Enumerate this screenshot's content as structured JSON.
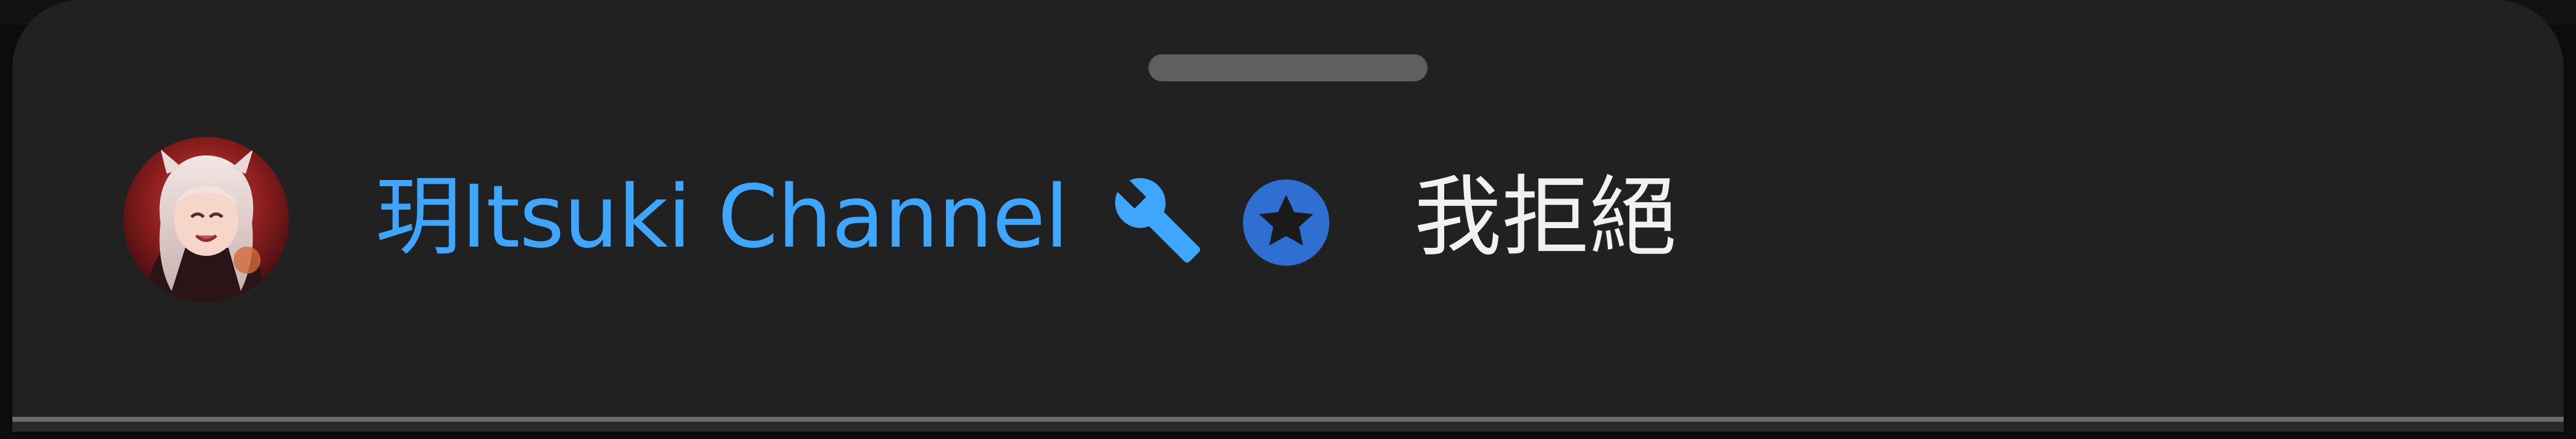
{
  "comment": {
    "channel_name": "玥Itsuki Channel",
    "message": "我拒絕",
    "badges": [
      "wrench-icon",
      "star-badge-icon"
    ]
  },
  "colors": {
    "sheet_background": "#212121",
    "channel_name": "#3ea6ff",
    "message_text": "#f1f1f1",
    "badge_circle": "#2f6fd1"
  }
}
